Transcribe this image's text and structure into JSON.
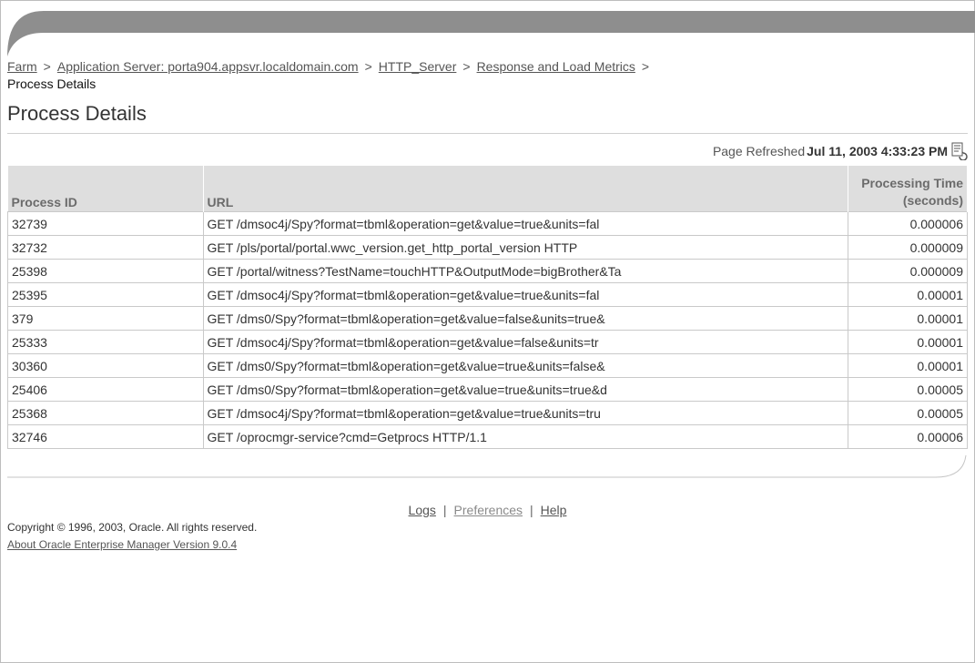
{
  "breadcrumb": {
    "items": [
      "Farm",
      "Application Server: porta904.appsvr.localdomain.com",
      "HTTP_Server",
      "Response and Load Metrics"
    ],
    "separator": ">",
    "current": "Process Details"
  },
  "page_title": "Process Details",
  "refresh": {
    "label": "Page Refreshed",
    "timestamp": "Jul 11, 2003 4:33:23 PM",
    "icon": "refresh-page-icon"
  },
  "table": {
    "headers": {
      "pid": "Process ID",
      "url": "URL",
      "time_line1": "Processing Time",
      "time_line2": "(seconds)"
    },
    "rows": [
      {
        "pid": "32739",
        "url": "GET /dmsoc4j/Spy?format=tbml&operation=get&value=true&units=fal",
        "time": "0.000006"
      },
      {
        "pid": "32732",
        "url": "GET /pls/portal/portal.wwc_version.get_http_portal_version HTTP",
        "time": "0.000009"
      },
      {
        "pid": "25398",
        "url": "GET /portal/witness?TestName=touchHTTP&OutputMode=bigBrother&Ta",
        "time": "0.000009"
      },
      {
        "pid": "25395",
        "url": "GET /dmsoc4j/Spy?format=tbml&operation=get&value=true&units=fal",
        "time": "0.00001"
      },
      {
        "pid": "379",
        "url": "GET /dms0/Spy?format=tbml&operation=get&value=false&units=true&",
        "time": "0.00001"
      },
      {
        "pid": "25333",
        "url": "GET /dmsoc4j/Spy?format=tbml&operation=get&value=false&units=tr",
        "time": "0.00001"
      },
      {
        "pid": "30360",
        "url": "GET /dms0/Spy?format=tbml&operation=get&value=true&units=false&",
        "time": "0.00001"
      },
      {
        "pid": "25406",
        "url": "GET /dms0/Spy?format=tbml&operation=get&value=true&units=true&d",
        "time": "0.00005"
      },
      {
        "pid": "25368",
        "url": "GET /dmsoc4j/Spy?format=tbml&operation=get&value=true&units=tru",
        "time": "0.00005"
      },
      {
        "pid": "32746",
        "url": "GET /oprocmgr-service?cmd=Getprocs HTTP/1.1",
        "time": "0.00006"
      }
    ]
  },
  "footer": {
    "links": {
      "logs": "Logs",
      "preferences": "Preferences",
      "help": "Help"
    },
    "separator": "|",
    "copyright": "Copyright © 1996, 2003, Oracle. All rights reserved.",
    "about": "About Oracle Enterprise Manager Version 9.0.4"
  }
}
